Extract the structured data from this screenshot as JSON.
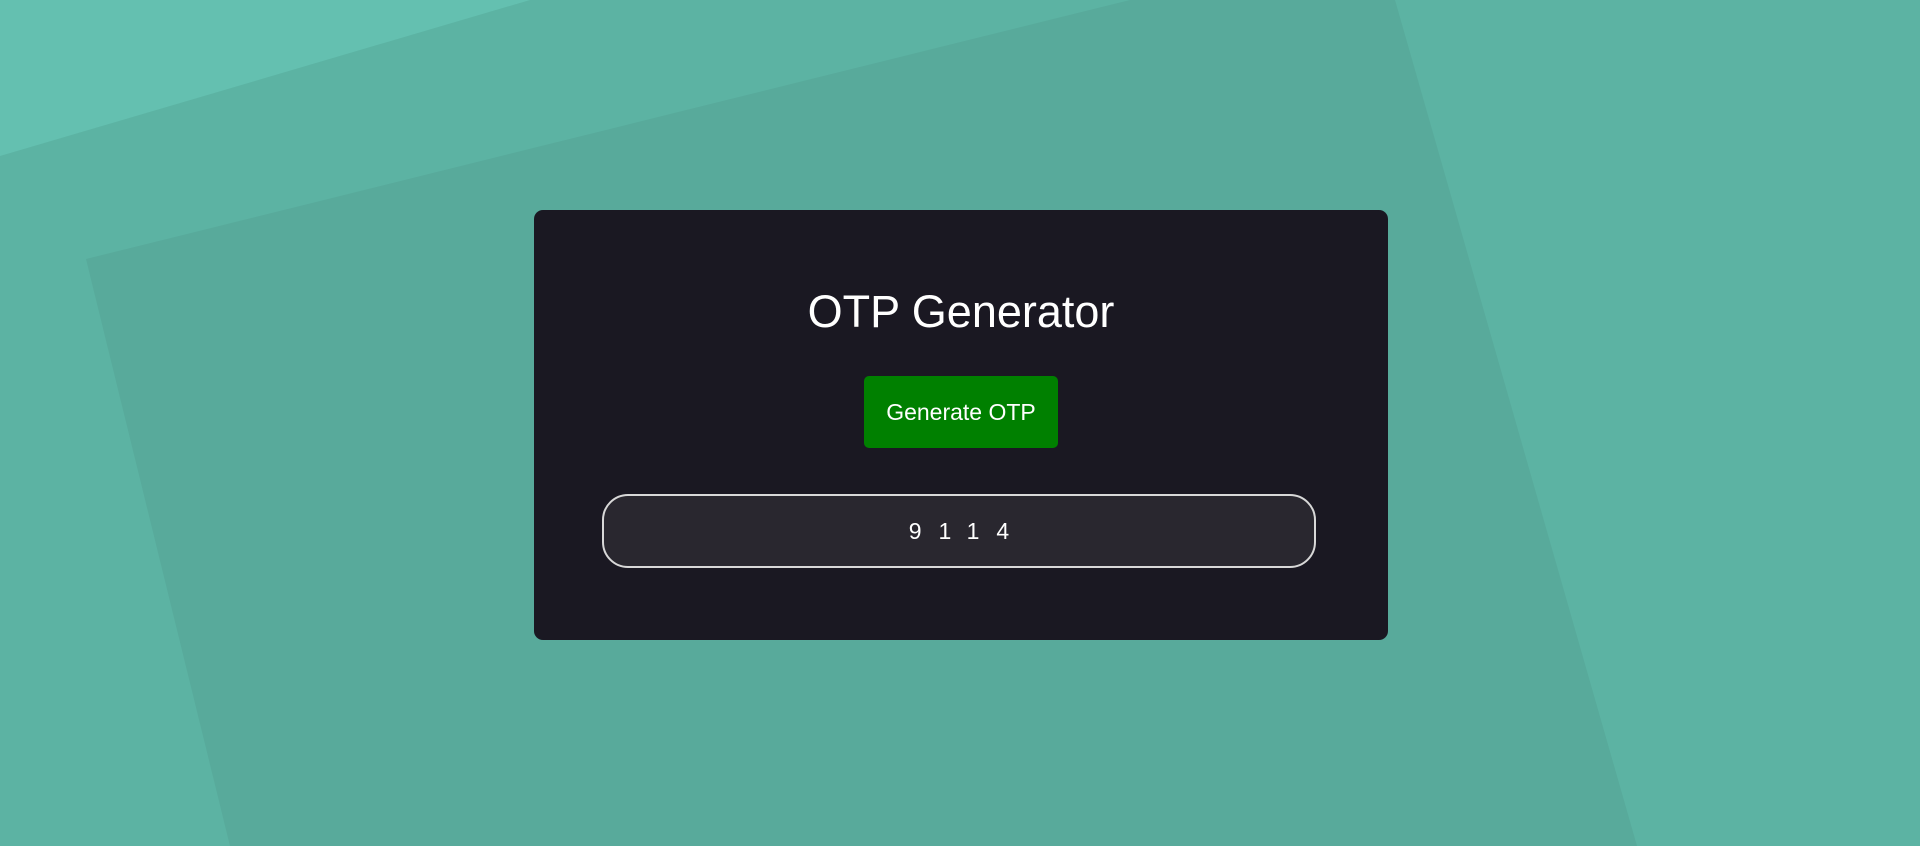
{
  "background": {
    "base_color": "#5cb3a3",
    "light_color": "#64c0b0",
    "dark_color": "#58aa9b"
  },
  "card": {
    "background_color": "#1a1822"
  },
  "title": "OTP Generator",
  "generate_button": {
    "label": "Generate OTP",
    "color": "#008000"
  },
  "otp_display": {
    "value": "9114",
    "background_color": "#29272f",
    "border_color": "#d8d8d8"
  }
}
